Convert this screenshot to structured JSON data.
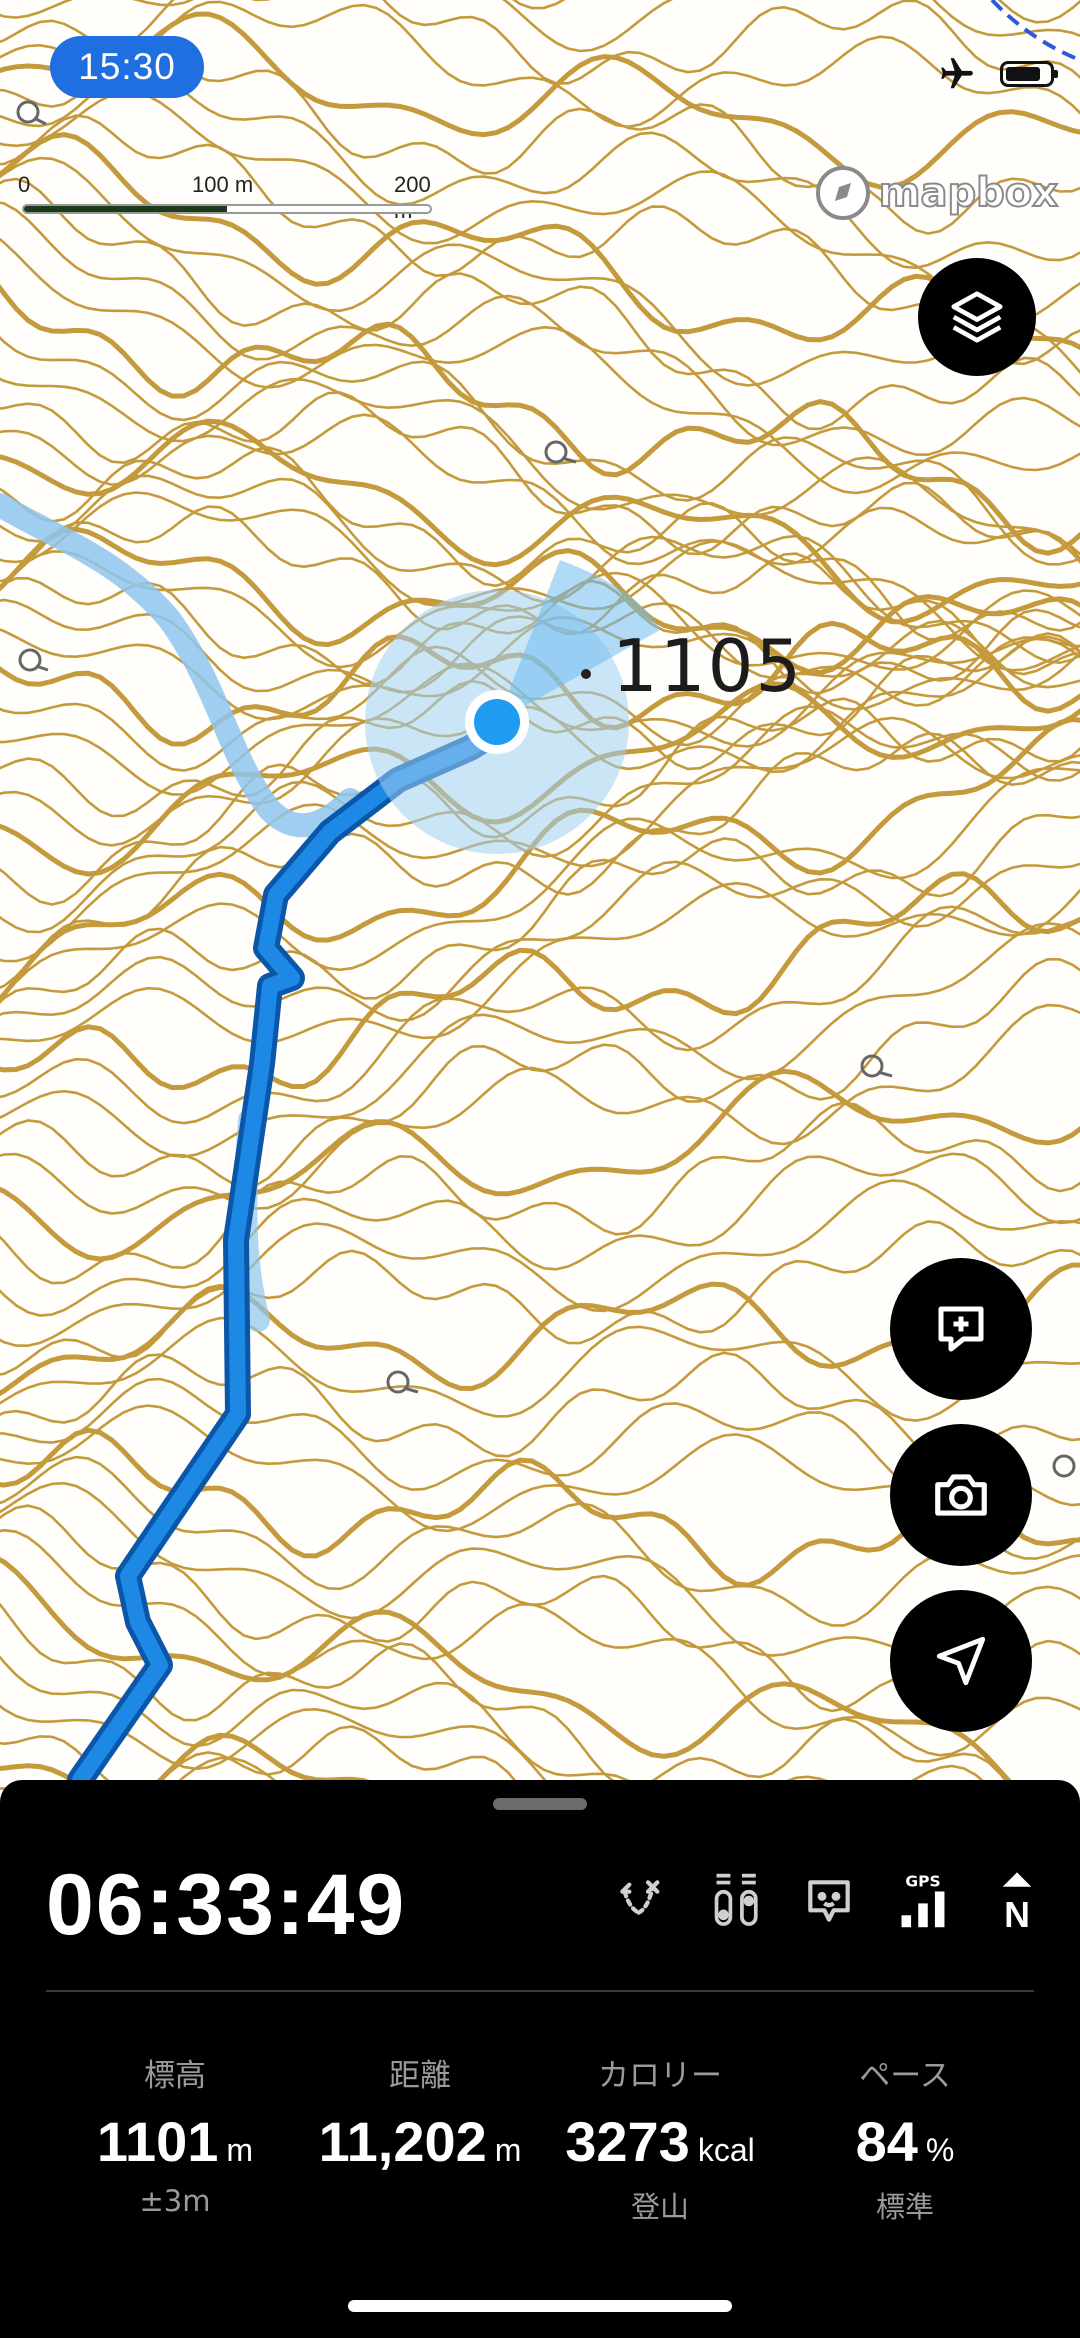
{
  "status_bar": {
    "time": "15:30",
    "airplane_icon": "airplane-icon",
    "battery_icon": "battery-icon"
  },
  "map": {
    "scale_labels": [
      "0",
      "100 m",
      "200 m"
    ],
    "attribution": "mapbox",
    "elevation_label": "1105",
    "colors": {
      "contour": "#c49a3c",
      "track": "#1e88e5",
      "planned_route": "#8ec6ee",
      "location": "#1f9bf0"
    }
  },
  "controls": {
    "layers_icon": "layers-icon",
    "add_note_icon": "add-note-icon",
    "camera_icon": "camera-icon",
    "navigate_icon": "location-arrow-icon"
  },
  "panel": {
    "elapsed_time": "06:33:49",
    "icons": [
      "route-icon",
      "signal-bars-icon",
      "pet-icon",
      "gps-icon",
      "north-icon"
    ],
    "gps_label": "GPS",
    "north_label": "N",
    "stats": [
      {
        "label": "標高",
        "value": "1101",
        "unit": "m",
        "sub": "±3m"
      },
      {
        "label": "距離",
        "value": "11,202",
        "unit": "m",
        "sub": ""
      },
      {
        "label": "カロリー",
        "value": "3273",
        "unit": "kcal",
        "sub": "登山"
      },
      {
        "label": "ペース",
        "value": "84",
        "unit": "%",
        "sub": "標準"
      }
    ]
  }
}
